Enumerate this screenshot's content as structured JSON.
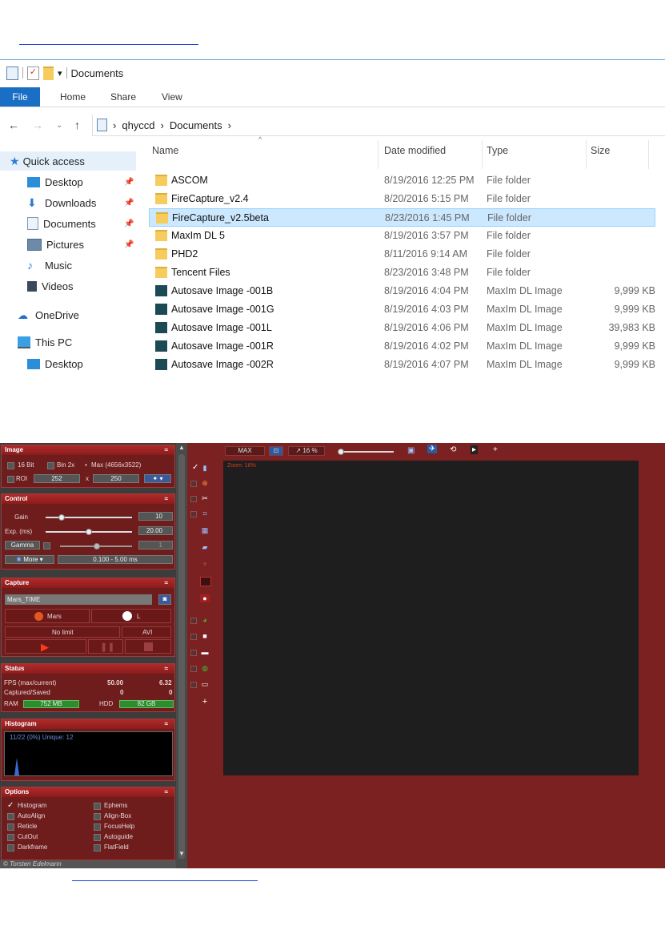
{
  "explorer": {
    "title": "Documents",
    "ribbon_tabs": [
      "File",
      "Home",
      "Share",
      "View"
    ],
    "path": [
      "qhyccd",
      "Documents"
    ],
    "nav": {
      "quick_access": "Quick access",
      "items": [
        "Desktop",
        "Downloads",
        "Documents",
        "Pictures",
        "Music",
        "Videos"
      ],
      "onedrive": "OneDrive",
      "thispc": "This PC",
      "pc_desktop": "Desktop"
    },
    "columns": {
      "name": "Name",
      "date": "Date modified",
      "type": "Type",
      "size": "Size"
    },
    "rows": [
      {
        "name": "ASCOM",
        "date": "8/19/2016 12:25 PM",
        "type": "File folder",
        "size": ""
      },
      {
        "name": "FireCapture_v2.4",
        "date": "8/20/2016 5:15 PM",
        "type": "File folder",
        "size": ""
      },
      {
        "name": "FireCapture_v2.5beta",
        "date": "8/23/2016 1:45 PM",
        "type": "File folder",
        "size": ""
      },
      {
        "name": "MaxIm DL 5",
        "date": "8/19/2016 3:57 PM",
        "type": "File folder",
        "size": ""
      },
      {
        "name": "PHD2",
        "date": "8/11/2016 9:14 AM",
        "type": "File folder",
        "size": ""
      },
      {
        "name": "Tencent Files",
        "date": "8/23/2016 3:48 PM",
        "type": "File folder",
        "size": ""
      },
      {
        "name": "Autosave Image -001B",
        "date": "8/19/2016 4:04 PM",
        "type": "MaxIm DL Image",
        "size": "9,999 KB"
      },
      {
        "name": "Autosave Image -001G",
        "date": "8/19/2016 4:03 PM",
        "type": "MaxIm DL Image",
        "size": "9,999 KB"
      },
      {
        "name": "Autosave Image -001L",
        "date": "8/19/2016 4:06 PM",
        "type": "MaxIm DL Image",
        "size": "39,983 KB"
      },
      {
        "name": "Autosave Image -001R",
        "date": "8/19/2016 4:02 PM",
        "type": "MaxIm DL Image",
        "size": "9,999 KB"
      },
      {
        "name": "Autosave Image -002R",
        "date": "8/19/2016 4:07 PM",
        "type": "MaxIm DL Image",
        "size": "9,999 KB"
      }
    ],
    "selected_row": "FireCapture_v2.5beta"
  },
  "firecapture": {
    "image": {
      "title": "Image",
      "bit16": "16 Bit",
      "bin": "Bin 2x",
      "max": "Max (4656x3522)",
      "roi": "ROI",
      "roi_w": "252",
      "x": "x",
      "roi_h": "250"
    },
    "control": {
      "title": "Control",
      "gain_label": "Gain",
      "gain_value": "10",
      "exp_label": "Exp. (ms)",
      "exp_value": "20.00",
      "gamma_label": "Gamma",
      "gamma_value": "1",
      "more": "More",
      "range": "0.100 - 5.00 ms"
    },
    "capture": {
      "title": "Capture",
      "filename": "Mars_TIME",
      "object": "Mars",
      "filter": "L",
      "limit": "No limit",
      "format": "AVI"
    },
    "status": {
      "title": "Status",
      "fps_label": "FPS (max/current)",
      "fps_max": "50.00",
      "fps_cur": "6.32",
      "cap_label": "Captured/Saved",
      "captured": "0",
      "saved": "0",
      "ram_label": "RAM",
      "ram_value": "752 MB",
      "hdd_label": "HDD",
      "hdd_value": "82 GB"
    },
    "histogram": {
      "title": "Histogram",
      "info": "11/22 (0%)  Unique: 12"
    },
    "options": {
      "title": "Options",
      "left": [
        "Histogram",
        "AutoAlign",
        "Reticle",
        "CutOut",
        "Darkframe"
      ],
      "right": [
        "Ephems",
        "Align-Box",
        "FocusHelp",
        "Autoguide",
        "FlatField"
      ],
      "checked": "Histogram"
    },
    "toolbar": {
      "max": "MAX",
      "zoom": "16 %",
      "plus": "+"
    },
    "viewer": {
      "zoom_label": "Zoom: 16%"
    },
    "sidebar_plus": "+",
    "footer": "© Torsten Edelmann",
    "colors": {
      "panel_bg": "#6e1c1c",
      "app_bg": "#7b2121",
      "accent_red": "#d63a20"
    }
  }
}
